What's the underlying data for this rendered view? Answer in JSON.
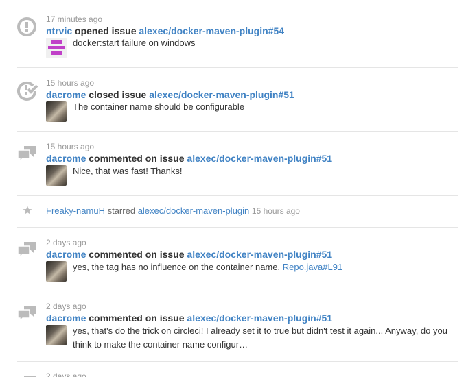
{
  "colors": {
    "link": "#4183c4",
    "muted": "#999999",
    "text": "#333333",
    "icon": "#bbbbbb",
    "divider": "#e5e5e5",
    "identicon": "#c040c8"
  },
  "events": [
    {
      "icon": "issue-opened-icon",
      "time": "17 minutes ago",
      "actor": "ntrvic",
      "action": "opened issue",
      "target": "alexec/docker-maven-plugin#54",
      "avatar": "identicon",
      "body": "docker:start failure on windows"
    },
    {
      "icon": "issue-closed-icon",
      "time": "15 hours ago",
      "actor": "dacrome",
      "action": "closed issue",
      "target": "alexec/docker-maven-plugin#51",
      "avatar": "person",
      "body": "The container name should be configurable"
    },
    {
      "icon": "comment-discussion-icon",
      "time": "15 hours ago",
      "actor": "dacrome",
      "action": "commented on issue",
      "target": "alexec/docker-maven-plugin#51",
      "avatar": "person",
      "body": "Nice, that was fast! Thanks!"
    },
    {
      "icon": "star-icon",
      "actor": "Freaky-namuH",
      "action": "starred",
      "target": "alexec/docker-maven-plugin",
      "time": "15 hours ago"
    },
    {
      "icon": "comment-discussion-icon",
      "time": "2 days ago",
      "actor": "dacrome",
      "action": "commented on issue",
      "target": "alexec/docker-maven-plugin#51",
      "avatar": "person",
      "body": "yes, the tag has no influence on the container name.",
      "body_link": "Repo.java#L91"
    },
    {
      "icon": "comment-discussion-icon",
      "time": "2 days ago",
      "actor": "dacrome",
      "action": "commented on issue",
      "target": "alexec/docker-maven-plugin#51",
      "avatar": "person",
      "body": "yes, that's do the trick on circleci! I already set it to true but didn't test it again... Anyway, do you think to make the container name configur…"
    },
    {
      "icon": "comment-discussion-icon",
      "time": "2 days ago"
    }
  ]
}
